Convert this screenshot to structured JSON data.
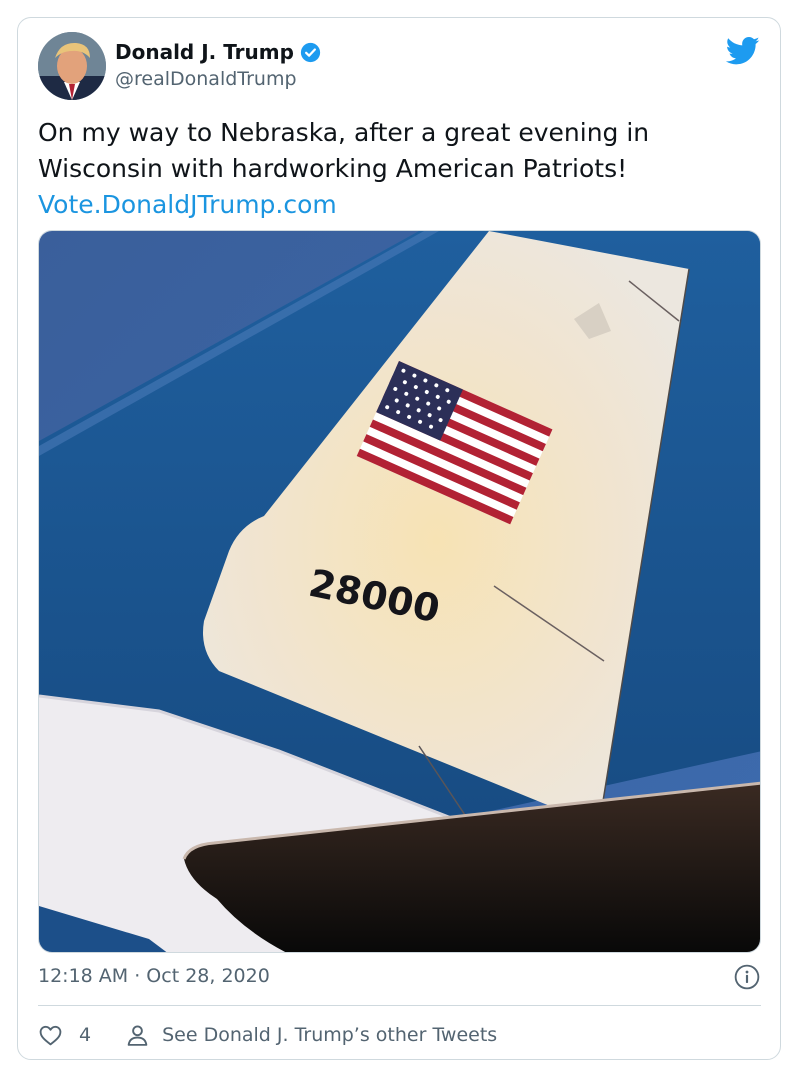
{
  "tweet": {
    "author_name": "Donald J. Trump",
    "author_handle": "@realDonaldTrump",
    "verified": true,
    "text_line1": "On my way to Nebraska, after a great evening in",
    "text_line2": "Wisconsin with hardworking American Patriots!",
    "link": "Vote.DonaldJTrump.com",
    "timestamp": "12:18 AM · Oct 28, 2020",
    "like_count": "4",
    "other_tweets_label": "See Donald J. Trump’s other Tweets"
  },
  "media": {
    "tail_number": "28000"
  },
  "icons": {
    "brand": "twitter-bird-icon",
    "verified": "verified-badge-icon",
    "info": "info-icon",
    "like": "heart-icon",
    "profile": "person-icon"
  },
  "colors": {
    "accent": "#1d9bf0",
    "link": "#1b95e0",
    "text": "#0f1419",
    "secondary_text": "#536471",
    "border": "#cfd9de",
    "sky": "#2f5a98",
    "flag_red": "#b22234",
    "flag_blue": "#2c2f58"
  }
}
